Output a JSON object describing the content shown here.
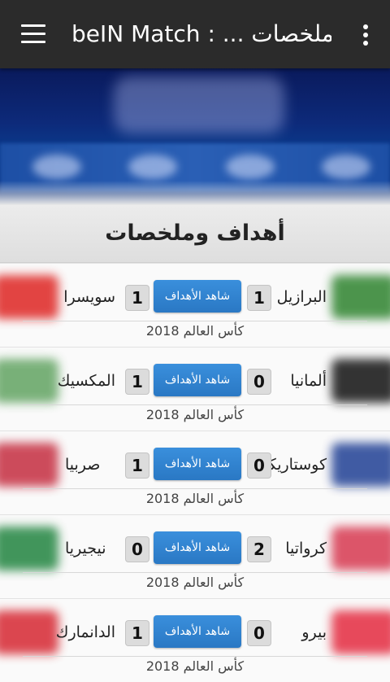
{
  "appbar": {
    "title": "beIN Match : ... ملخصات"
  },
  "section": {
    "title": "أهداف وملخصات"
  },
  "matches": [
    {
      "home": "البرازيل",
      "home_score": "1",
      "away": "سويسرا",
      "away_score": "1",
      "button": "شاهد الأهداف",
      "competition": "كأس العالم 2018",
      "home_flag": "#3a8a3a",
      "away_flag": "#e0312f"
    },
    {
      "home": "ألمانيا",
      "home_score": "0",
      "away": "المكسيك",
      "away_score": "1",
      "button": "شاهد الأهداف",
      "competition": "كأس العالم 2018",
      "home_flag": "#1e1e1e",
      "away_flag": "#6aa86a"
    },
    {
      "home": "كوستاريكا",
      "home_score": "0",
      "away": "صربيا",
      "away_score": "1",
      "button": "شاهد الأهداف",
      "competition": "كأس العالم 2018",
      "home_flag": "#2c4a9a",
      "away_flag": "#c8394a"
    },
    {
      "home": "كرواتيا",
      "home_score": "2",
      "away": "نيجيريا",
      "away_score": "0",
      "button": "شاهد الأهداف",
      "competition": "كأس العالم 2018",
      "home_flag": "#d9445a",
      "away_flag": "#2e8b4a"
    },
    {
      "home": "بيرو",
      "home_score": "0",
      "away": "الدانمارك",
      "away_score": "1",
      "button": "شاهد الأهداف",
      "competition": "كأس العالم 2018",
      "home_flag": "#e5364a",
      "away_flag": "#d8333d"
    }
  ],
  "colors": {
    "appbar": "#2b2b2b",
    "button": "#2a78c4",
    "banner": "#0d2a7a"
  },
  "icons": {
    "menu": "hamburger-icon",
    "overflow": "more-vert-icon"
  }
}
